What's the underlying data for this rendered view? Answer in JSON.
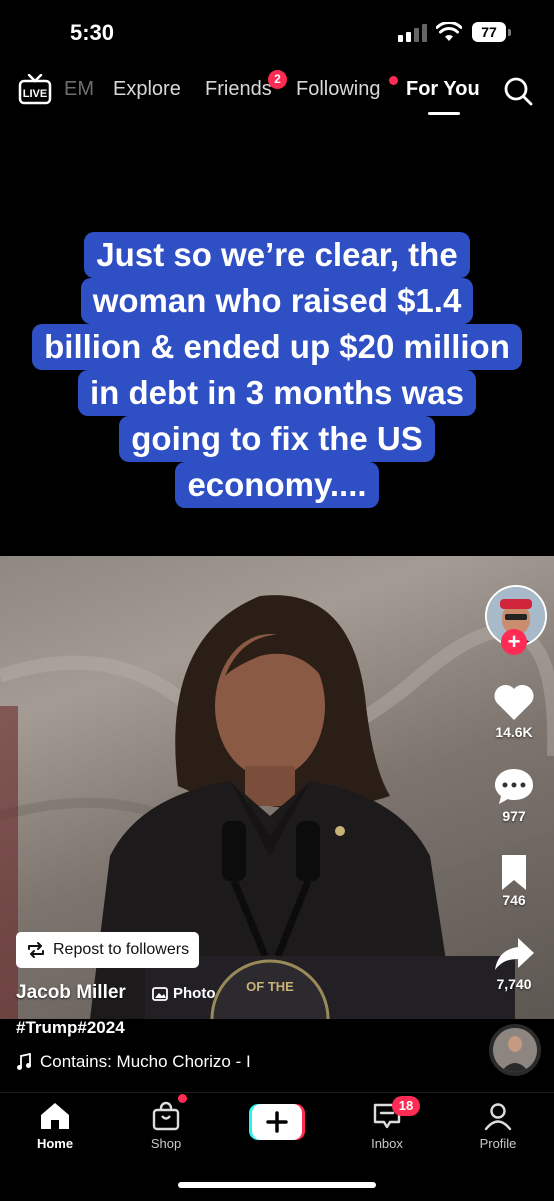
{
  "status_bar": {
    "time": "5:30",
    "battery": "77"
  },
  "top_nav": {
    "live_label": "LIVE",
    "tabs": [
      {
        "label": "EM"
      },
      {
        "label": "Explore"
      },
      {
        "label": "Friends",
        "badge": "2"
      },
      {
        "label": "Following"
      },
      {
        "label": "For You"
      }
    ]
  },
  "post": {
    "caption_lines": [
      "Just so we’re clear,  the",
      "woman who raised $1.4",
      "billion & ended up $20 million",
      "in debt in 3 months was",
      "going to fix the US",
      "economy...."
    ],
    "seal_text": "OF THE",
    "repost_label": "Repost to followers",
    "author": "Jacob Miller",
    "photo_tag": "Photo",
    "hashtags": "#Trump#2024",
    "music": "Contains: Mucho Chorizo - I"
  },
  "actions": {
    "likes": "14.6K",
    "comments": "977",
    "saves": "746",
    "shares": "7,740"
  },
  "bottom_nav": {
    "home": "Home",
    "shop": "Shop",
    "inbox": "Inbox",
    "inbox_badge": "18",
    "profile": "Profile"
  },
  "colors": {
    "caption_bg": "#2f4fc4",
    "accent": "#fe2c55",
    "background": "#000000"
  }
}
